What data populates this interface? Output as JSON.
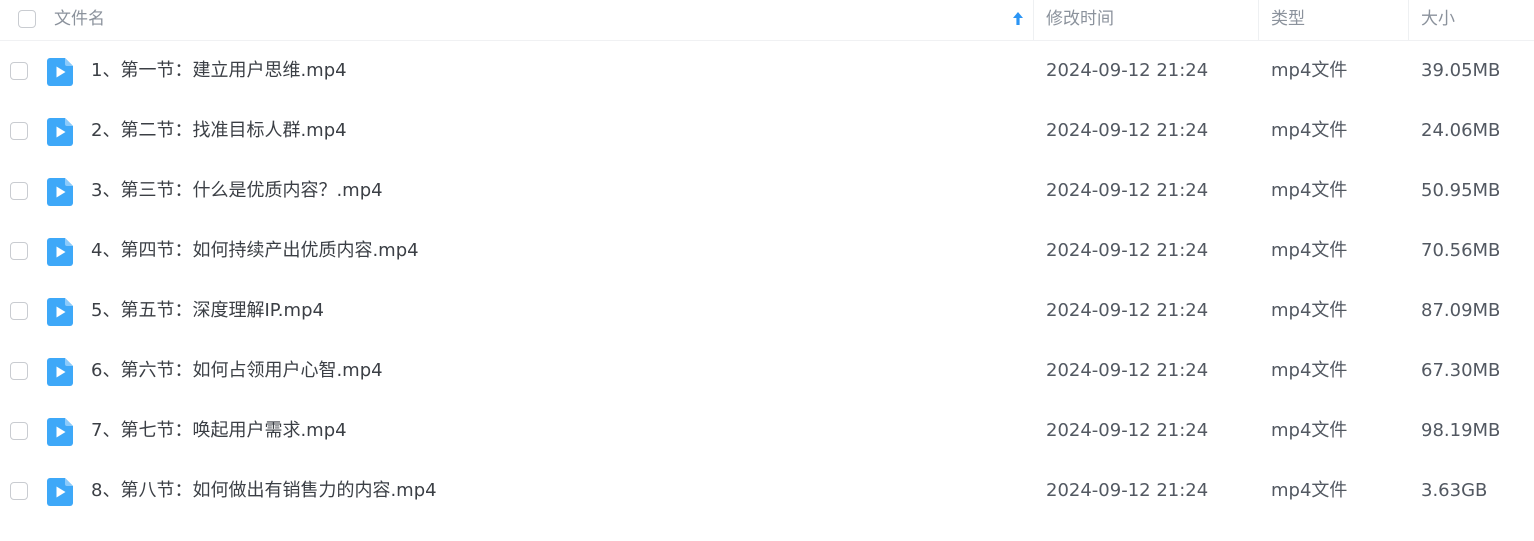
{
  "header": {
    "name_label": "文件名",
    "modified_label": "修改时间",
    "type_label": "类型",
    "size_label": "大小",
    "sort_icon": "arrow-up-icon"
  },
  "colors": {
    "accent": "#2b95f5",
    "icon_blue": "#3ea8f8",
    "text": "#3b3f45",
    "muted": "#8b929c"
  },
  "files": [
    {
      "name": "1、第一节：建立用户思维.mp4",
      "modified": "2024-09-12 21:24",
      "type": "mp4文件",
      "size": "39.05MB",
      "icon": "video-file-icon"
    },
    {
      "name": "2、第二节：找准目标人群.mp4",
      "modified": "2024-09-12 21:24",
      "type": "mp4文件",
      "size": "24.06MB",
      "icon": "video-file-icon"
    },
    {
      "name": "3、第三节：什么是优质内容？.mp4",
      "modified": "2024-09-12 21:24",
      "type": "mp4文件",
      "size": "50.95MB",
      "icon": "video-file-icon"
    },
    {
      "name": "4、第四节：如何持续产出优质内容.mp4",
      "modified": "2024-09-12 21:24",
      "type": "mp4文件",
      "size": "70.56MB",
      "icon": "video-file-icon"
    },
    {
      "name": "5、第五节：深度理解IP.mp4",
      "modified": "2024-09-12 21:24",
      "type": "mp4文件",
      "size": "87.09MB",
      "icon": "video-file-icon"
    },
    {
      "name": "6、第六节：如何占领用户心智.mp4",
      "modified": "2024-09-12 21:24",
      "type": "mp4文件",
      "size": "67.30MB",
      "icon": "video-file-icon"
    },
    {
      "name": "7、第七节：唤起用户需求.mp4",
      "modified": "2024-09-12 21:24",
      "type": "mp4文件",
      "size": "98.19MB",
      "icon": "video-file-icon"
    },
    {
      "name": "8、第八节：如何做出有销售力的内容.mp4",
      "modified": "2024-09-12 21:24",
      "type": "mp4文件",
      "size": "3.63GB",
      "icon": "video-file-icon"
    }
  ]
}
